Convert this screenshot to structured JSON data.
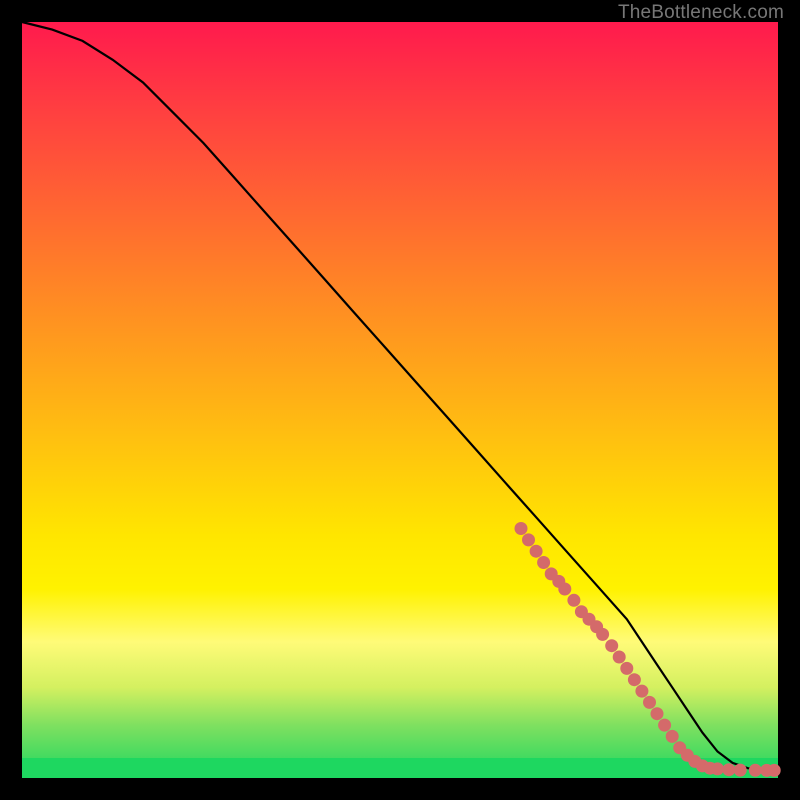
{
  "watermark": "TheBottleneck.com",
  "colors": {
    "curve": "#000000",
    "markers": "#d46a6a",
    "background_top": "#ff1a4d",
    "background_bottom": "#1ed760"
  },
  "chart_data": {
    "type": "line",
    "title": "",
    "xlabel": "",
    "ylabel": "",
    "xlim": [
      0,
      100
    ],
    "ylim": [
      0,
      100
    ],
    "grid": false,
    "legend": false,
    "series": [
      {
        "name": "curve",
        "x": [
          0,
          4,
          8,
          12,
          16,
          20,
          24,
          28,
          32,
          36,
          40,
          44,
          48,
          52,
          56,
          60,
          64,
          68,
          72,
          76,
          80,
          82,
          84,
          86,
          88,
          90,
          92,
          94,
          96,
          98,
          100
        ],
        "y": [
          100,
          99,
          97.5,
          95,
          92,
          88,
          84,
          79.5,
          75,
          70.5,
          66,
          61.5,
          57,
          52.5,
          48,
          43.5,
          39,
          34.5,
          30,
          25.5,
          21,
          18,
          15,
          12,
          9,
          6,
          3.5,
          2,
          1.3,
          1.1,
          1
        ]
      }
    ],
    "markers": [
      {
        "x": 66,
        "y": 33
      },
      {
        "x": 67,
        "y": 31.5
      },
      {
        "x": 68,
        "y": 30
      },
      {
        "x": 69,
        "y": 28.5
      },
      {
        "x": 70,
        "y": 27
      },
      {
        "x": 71,
        "y": 26
      },
      {
        "x": 71.8,
        "y": 25
      },
      {
        "x": 73,
        "y": 23.5
      },
      {
        "x": 74,
        "y": 22
      },
      {
        "x": 75,
        "y": 21
      },
      {
        "x": 76,
        "y": 20
      },
      {
        "x": 76.8,
        "y": 19
      },
      {
        "x": 78,
        "y": 17.5
      },
      {
        "x": 79,
        "y": 16
      },
      {
        "x": 80,
        "y": 14.5
      },
      {
        "x": 81,
        "y": 13
      },
      {
        "x": 82,
        "y": 11.5
      },
      {
        "x": 83,
        "y": 10
      },
      {
        "x": 84,
        "y": 8.5
      },
      {
        "x": 85,
        "y": 7
      },
      {
        "x": 86,
        "y": 5.5
      },
      {
        "x": 87,
        "y": 4
      },
      {
        "x": 88,
        "y": 3
      },
      {
        "x": 89,
        "y": 2.2
      },
      {
        "x": 90,
        "y": 1.6
      },
      {
        "x": 91,
        "y": 1.3
      },
      {
        "x": 92,
        "y": 1.2
      },
      {
        "x": 93.5,
        "y": 1.1
      },
      {
        "x": 95,
        "y": 1.05
      },
      {
        "x": 97,
        "y": 1.02
      },
      {
        "x": 98.5,
        "y": 1.01
      },
      {
        "x": 99.5,
        "y": 1.0
      }
    ]
  }
}
